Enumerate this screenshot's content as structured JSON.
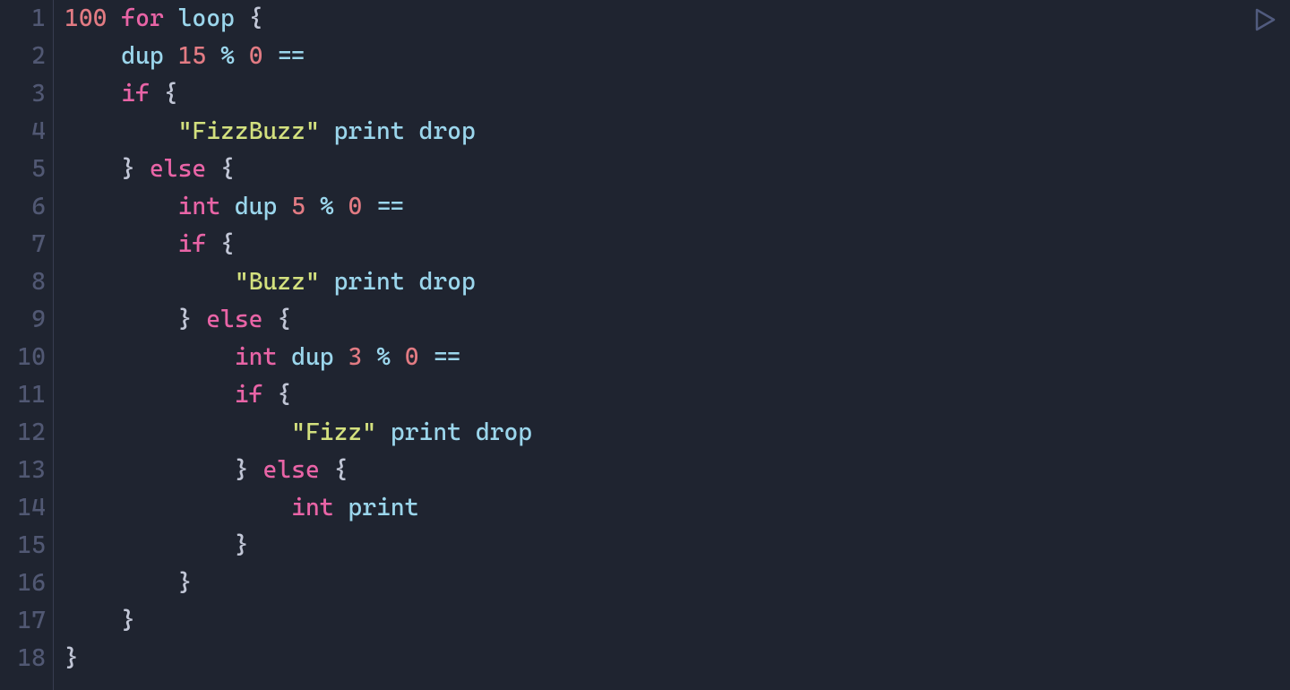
{
  "editor": {
    "line_count": 18,
    "tab": "    ",
    "colors": {
      "background": "#1f2430",
      "gutter_foreground": "#515873",
      "gutter_border": "#373d50",
      "default_text": "#c1c6d6",
      "number": "#e27b83",
      "keyword": "#e864a6",
      "identifier": "#9bd6ec",
      "string": "#d3e07e",
      "operator": "#9bd6ec",
      "punct": "#c1c6d6",
      "run_icon": "#515b7e"
    },
    "lines": [
      {
        "n": 1,
        "indent": 0,
        "tokens": [
          [
            "num",
            "100"
          ],
          [
            "sp",
            " "
          ],
          [
            "kw",
            "for"
          ],
          [
            "sp",
            " "
          ],
          [
            "ident",
            "loop"
          ],
          [
            "sp",
            " "
          ],
          [
            "punct",
            "{"
          ]
        ]
      },
      {
        "n": 2,
        "indent": 1,
        "tokens": [
          [
            "ident",
            "dup"
          ],
          [
            "sp",
            " "
          ],
          [
            "num",
            "15"
          ],
          [
            "sp",
            " "
          ],
          [
            "op",
            "%"
          ],
          [
            "sp",
            " "
          ],
          [
            "num",
            "0"
          ],
          [
            "sp",
            " "
          ],
          [
            "op",
            "=="
          ]
        ]
      },
      {
        "n": 3,
        "indent": 1,
        "tokens": [
          [
            "kw",
            "if"
          ],
          [
            "sp",
            " "
          ],
          [
            "punct",
            "{"
          ]
        ]
      },
      {
        "n": 4,
        "indent": 2,
        "tokens": [
          [
            "str",
            "\"FizzBuzz\""
          ],
          [
            "sp",
            " "
          ],
          [
            "ident",
            "print"
          ],
          [
            "sp",
            " "
          ],
          [
            "ident",
            "drop"
          ]
        ]
      },
      {
        "n": 5,
        "indent": 1,
        "tokens": [
          [
            "punct",
            "}"
          ],
          [
            "sp",
            " "
          ],
          [
            "kw",
            "else"
          ],
          [
            "sp",
            " "
          ],
          [
            "punct",
            "{"
          ]
        ]
      },
      {
        "n": 6,
        "indent": 2,
        "tokens": [
          [
            "type",
            "int"
          ],
          [
            "sp",
            " "
          ],
          [
            "ident",
            "dup"
          ],
          [
            "sp",
            " "
          ],
          [
            "num",
            "5"
          ],
          [
            "sp",
            " "
          ],
          [
            "op",
            "%"
          ],
          [
            "sp",
            " "
          ],
          [
            "num",
            "0"
          ],
          [
            "sp",
            " "
          ],
          [
            "op",
            "=="
          ]
        ]
      },
      {
        "n": 7,
        "indent": 2,
        "tokens": [
          [
            "kw",
            "if"
          ],
          [
            "sp",
            " "
          ],
          [
            "punct",
            "{"
          ]
        ]
      },
      {
        "n": 8,
        "indent": 3,
        "tokens": [
          [
            "str",
            "\"Buzz\""
          ],
          [
            "sp",
            " "
          ],
          [
            "ident",
            "print"
          ],
          [
            "sp",
            " "
          ],
          [
            "ident",
            "drop"
          ]
        ]
      },
      {
        "n": 9,
        "indent": 2,
        "tokens": [
          [
            "punct",
            "}"
          ],
          [
            "sp",
            " "
          ],
          [
            "kw",
            "else"
          ],
          [
            "sp",
            " "
          ],
          [
            "punct",
            "{"
          ]
        ]
      },
      {
        "n": 10,
        "indent": 3,
        "tokens": [
          [
            "type",
            "int"
          ],
          [
            "sp",
            " "
          ],
          [
            "ident",
            "dup"
          ],
          [
            "sp",
            " "
          ],
          [
            "num",
            "3"
          ],
          [
            "sp",
            " "
          ],
          [
            "op",
            "%"
          ],
          [
            "sp",
            " "
          ],
          [
            "num",
            "0"
          ],
          [
            "sp",
            " "
          ],
          [
            "op",
            "=="
          ]
        ]
      },
      {
        "n": 11,
        "indent": 3,
        "tokens": [
          [
            "kw",
            "if"
          ],
          [
            "sp",
            " "
          ],
          [
            "punct",
            "{"
          ]
        ]
      },
      {
        "n": 12,
        "indent": 4,
        "tokens": [
          [
            "str",
            "\"Fizz\""
          ],
          [
            "sp",
            " "
          ],
          [
            "ident",
            "print"
          ],
          [
            "sp",
            " "
          ],
          [
            "ident",
            "drop"
          ]
        ]
      },
      {
        "n": 13,
        "indent": 3,
        "tokens": [
          [
            "punct",
            "}"
          ],
          [
            "sp",
            " "
          ],
          [
            "kw",
            "else"
          ],
          [
            "sp",
            " "
          ],
          [
            "punct",
            "{"
          ]
        ]
      },
      {
        "n": 14,
        "indent": 4,
        "tokens": [
          [
            "type",
            "int"
          ],
          [
            "sp",
            " "
          ],
          [
            "ident",
            "print"
          ]
        ]
      },
      {
        "n": 15,
        "indent": 3,
        "tokens": [
          [
            "punct",
            "}"
          ]
        ]
      },
      {
        "n": 16,
        "indent": 2,
        "tokens": [
          [
            "punct",
            "}"
          ]
        ]
      },
      {
        "n": 17,
        "indent": 1,
        "tokens": [
          [
            "punct",
            "}"
          ]
        ]
      },
      {
        "n": 18,
        "indent": 0,
        "tokens": [
          [
            "punct",
            "}"
          ]
        ]
      }
    ]
  },
  "controls": {
    "run_icon": "play-icon"
  }
}
